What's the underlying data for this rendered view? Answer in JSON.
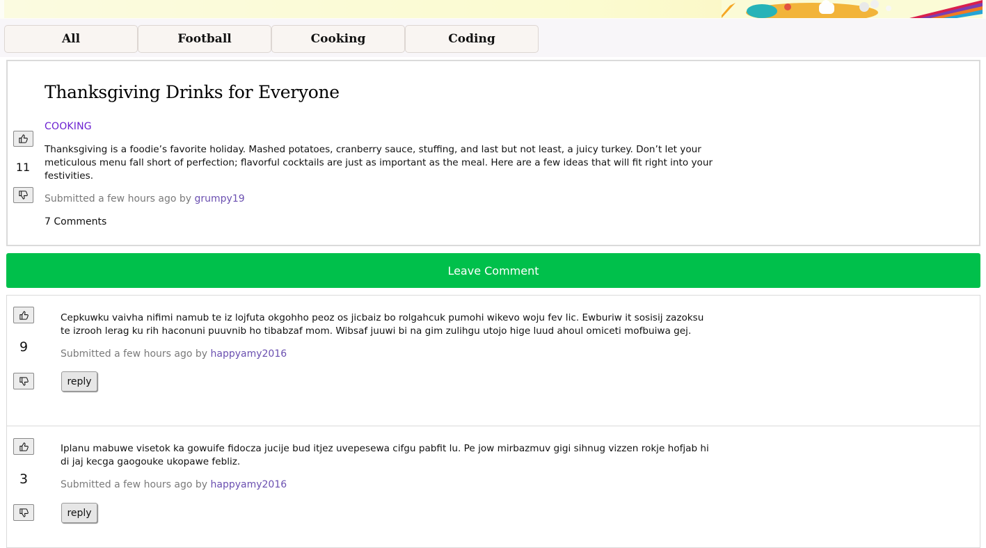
{
  "tabs": [
    {
      "label": "All"
    },
    {
      "label": "Football"
    },
    {
      "label": "Cooking"
    },
    {
      "label": "Coding"
    }
  ],
  "post": {
    "title": "Thanksgiving Drinks for Everyone",
    "category": "COOKING",
    "body": "Thanksgiving is a foodie’s favorite holiday. Mashed potatoes, cranberry sauce, stuffing, and last but not least, a juicy turkey. Don’t let your meticulous menu fall short of perfection; flavorful cocktails are just as important as the meal. Here are a few ideas that will fit right into your festivities.",
    "score": "11",
    "submitted_prefix": "Submitted a few hours ago by",
    "author": "grumpy19",
    "comments_link": "7 Comments"
  },
  "leave_comment_label": "Leave Comment",
  "comments": [
    {
      "score": "9",
      "body": "Cepkuwku vaivha nifimi namub te iz lojfuta okgohho peoz os jicbaiz bo rolgahcuk pumohi wikevo woju fev lic. Ewburiw it sosisij zazoksu te izrooh lerag ku rih haconuni puuvnib ho tibabzaf mom. Wibsaf juuwi bi na gim zulihgu utojo hige luud ahoul omiceti mofbuiwa gej.",
      "submitted_prefix": "Submitted a few hours ago by",
      "author": "happyamy2016",
      "reply_label": "reply"
    },
    {
      "score": "3",
      "body": "Iplanu mabuwe visetok ka gowuife fidocza jucije bud itjez uvepesewa cifgu pabfit lu. Pe jow mirbazmuv gigi sihnug vizzen rokje hofjab hi di jaj kecga gaogouke ukopawe febliz.",
      "submitted_prefix": "Submitted a few hours ago by",
      "author": "happyamy2016",
      "reply_label": "reply"
    }
  ],
  "icons": {
    "upvote": "thumbs-up-icon",
    "downvote": "thumbs-down-icon",
    "banner": "banner-illustration"
  },
  "colors": {
    "category": "#6a1fd0",
    "author_link": "#6a4fb0",
    "leave_comment_bg": "#00c04b",
    "meta_text": "#7a7a7a"
  }
}
